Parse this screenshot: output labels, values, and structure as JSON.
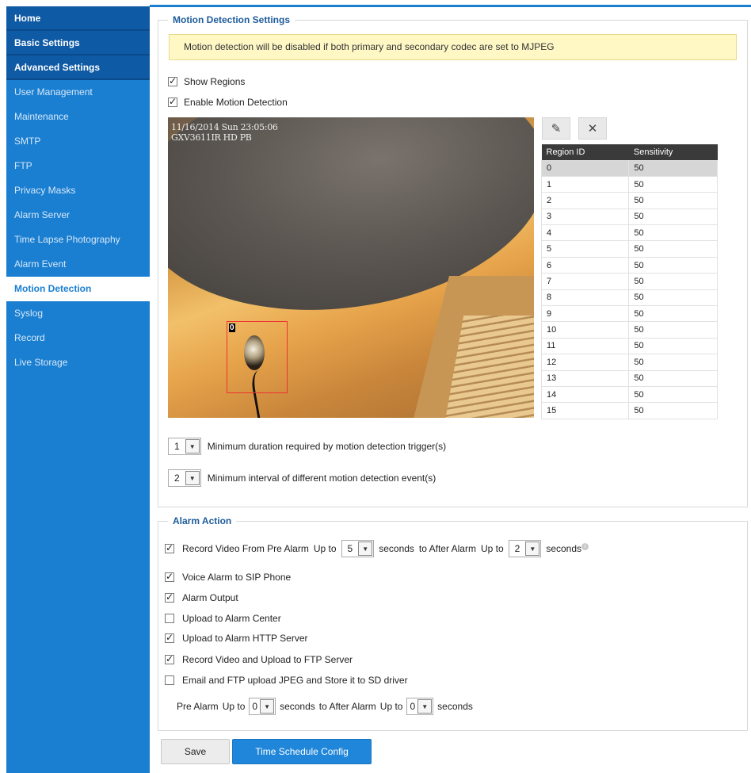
{
  "sidebar": {
    "home": "Home",
    "basic": "Basic Settings",
    "advanced": "Advanced Settings",
    "items": [
      {
        "label": "User Management"
      },
      {
        "label": "Maintenance"
      },
      {
        "label": "SMTP"
      },
      {
        "label": "FTP"
      },
      {
        "label": "Privacy Masks"
      },
      {
        "label": "Alarm Server"
      },
      {
        "label": "Time Lapse Photography"
      },
      {
        "label": "Alarm Event"
      },
      {
        "label": "Motion Detection"
      },
      {
        "label": "Syslog"
      },
      {
        "label": "Record"
      },
      {
        "label": "Live Storage"
      }
    ]
  },
  "motion": {
    "legend": "Motion Detection Settings",
    "warning": "Motion detection will be disabled if both primary and secondary codec are set to MJPEG",
    "show_regions": {
      "label": "Show Regions",
      "checked": true
    },
    "enable": {
      "label": "Enable Motion Detection",
      "checked": true
    },
    "camera": {
      "timestamp": "11/16/2014 Sun 23:05:06",
      "device": "GXV3611IR HD PB",
      "region_label": "0"
    },
    "table": {
      "headers": [
        "Region ID",
        "Sensitivity"
      ],
      "rows": [
        [
          "0",
          "50"
        ],
        [
          "1",
          "50"
        ],
        [
          "2",
          "50"
        ],
        [
          "3",
          "50"
        ],
        [
          "4",
          "50"
        ],
        [
          "5",
          "50"
        ],
        [
          "6",
          "50"
        ],
        [
          "7",
          "50"
        ],
        [
          "8",
          "50"
        ],
        [
          "9",
          "50"
        ],
        [
          "10",
          "50"
        ],
        [
          "11",
          "50"
        ],
        [
          "12",
          "50"
        ],
        [
          "13",
          "50"
        ],
        [
          "14",
          "50"
        ],
        [
          "15",
          "50"
        ]
      ]
    },
    "duration": {
      "value": "1",
      "label": "Minimum duration required by motion detection trigger(s)"
    },
    "interval": {
      "value": "2",
      "label": "Minimum interval of different motion detection event(s)"
    }
  },
  "alarm": {
    "legend": "Alarm Action",
    "record_pre": {
      "label": "Record Video From Pre Alarm",
      "upto1": "Up to",
      "pre_value": "5",
      "seconds1": "seconds",
      "to_after": "to After Alarm",
      "upto2": "Up to",
      "post_value": "2",
      "seconds2": "seconds",
      "checked": true
    },
    "options": [
      {
        "label": "Voice Alarm to SIP Phone",
        "checked": true
      },
      {
        "label": "Alarm Output",
        "checked": true
      },
      {
        "label": "Upload to Alarm Center",
        "checked": false
      },
      {
        "label": "Upload to Alarm HTTP Server",
        "checked": true
      },
      {
        "label": "Record Video and Upload to FTP Server",
        "checked": true
      },
      {
        "label": "Email and FTP upload JPEG and Store it to SD driver",
        "checked": false
      }
    ],
    "jpeg": {
      "pre_alarm": "Pre Alarm",
      "upto1": "Up to",
      "pre_value": "0",
      "seconds1": "seconds",
      "to_after": "to After Alarm",
      "upto2": "Up to",
      "post_value": "0",
      "seconds2": "seconds"
    }
  },
  "buttons": {
    "save": "Save",
    "schedule": "Time Schedule Config"
  }
}
